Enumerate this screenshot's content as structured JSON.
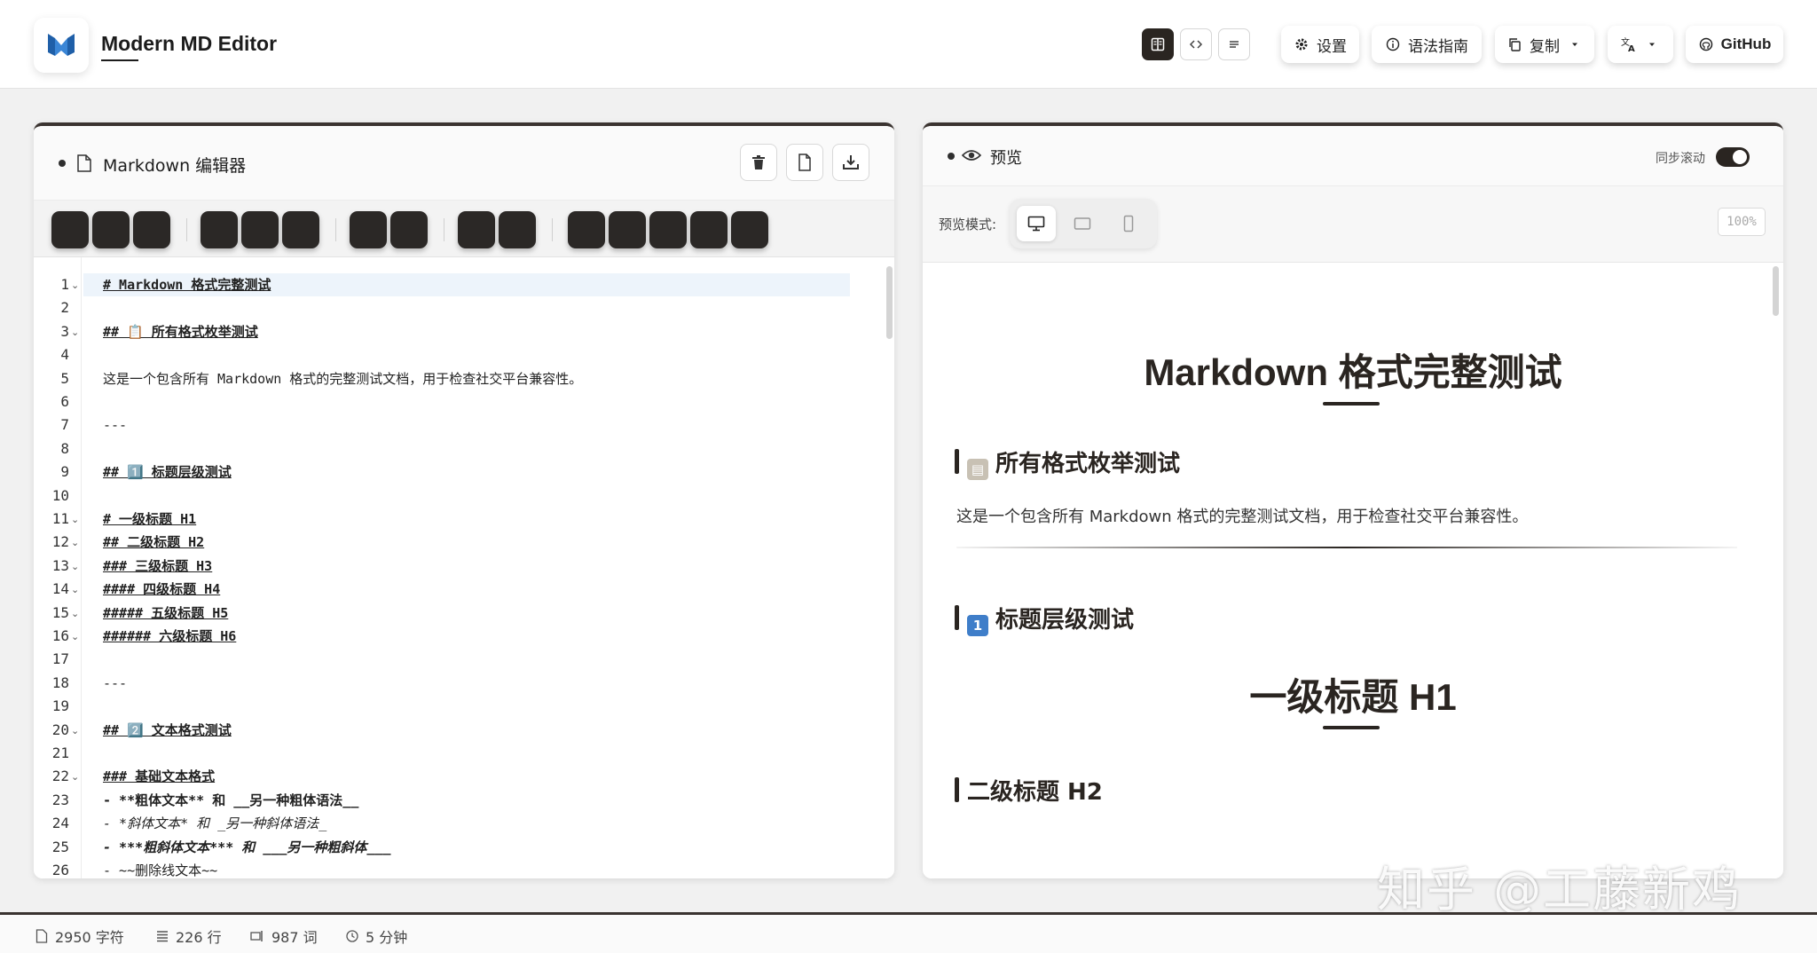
{
  "app": {
    "title": "Modern MD Editor"
  },
  "header": {
    "settings_label": "设置",
    "guide_label": "语法指南",
    "copy_label": "复制",
    "github_label": "GitHub"
  },
  "editor": {
    "title": "Markdown 编辑器",
    "lines": [
      {
        "n": "1",
        "fold": true,
        "text": "# Markdown 格式完整测试",
        "style": "hd"
      },
      {
        "n": "2",
        "fold": false,
        "text": "",
        "style": ""
      },
      {
        "n": "3",
        "fold": true,
        "text": "## 📋 所有格式枚举测试",
        "style": "hd"
      },
      {
        "n": "4",
        "fold": false,
        "text": "",
        "style": ""
      },
      {
        "n": "5",
        "fold": false,
        "text": "这是一个包含所有 Markdown 格式的完整测试文档，用于检查社交平台兼容性。",
        "style": ""
      },
      {
        "n": "6",
        "fold": false,
        "text": "",
        "style": ""
      },
      {
        "n": "7",
        "fold": false,
        "text": "---",
        "style": ""
      },
      {
        "n": "8",
        "fold": false,
        "text": "",
        "style": ""
      },
      {
        "n": "9",
        "fold": false,
        "text": "## 1️⃣ 标题层级测试",
        "style": "hd"
      },
      {
        "n": "10",
        "fold": false,
        "text": "",
        "style": ""
      },
      {
        "n": "11",
        "fold": true,
        "text": "# 一级标题 H1",
        "style": "hd"
      },
      {
        "n": "12",
        "fold": true,
        "text": "## 二级标题 H2",
        "style": "hd"
      },
      {
        "n": "13",
        "fold": true,
        "text": "### 三级标题 H3",
        "style": "hd"
      },
      {
        "n": "14",
        "fold": true,
        "text": "#### 四级标题 H4",
        "style": "hd"
      },
      {
        "n": "15",
        "fold": true,
        "text": "##### 五级标题 H5",
        "style": "hd"
      },
      {
        "n": "16",
        "fold": true,
        "text": "###### 六级标题 H6",
        "style": "hd"
      },
      {
        "n": "17",
        "fold": false,
        "text": "",
        "style": ""
      },
      {
        "n": "18",
        "fold": false,
        "text": "---",
        "style": ""
      },
      {
        "n": "19",
        "fold": false,
        "text": "",
        "style": ""
      },
      {
        "n": "20",
        "fold": true,
        "text": "## 2️⃣ 文本格式测试",
        "style": "hd"
      },
      {
        "n": "21",
        "fold": false,
        "text": "",
        "style": ""
      },
      {
        "n": "22",
        "fold": true,
        "text": "### 基础文本格式",
        "style": "hd"
      },
      {
        "n": "23",
        "fold": false,
        "text": "- **粗体文本** 和 __另一种粗体语法__",
        "style": "bd"
      },
      {
        "n": "24",
        "fold": false,
        "text": "- *斜体文本* 和 _另一种斜体语法_",
        "style": "em"
      },
      {
        "n": "25",
        "fold": false,
        "text": "- ***粗斜体文本*** 和 ___另一种粗斜体___",
        "style": "bd em"
      },
      {
        "n": "26",
        "fold": false,
        "text": "- ~~删除线文本~~",
        "style": ""
      }
    ]
  },
  "preview": {
    "title": "预览",
    "sync_label": "同步滚动",
    "mode_label": "预览模式:",
    "zoom": "100%",
    "h1": "Markdown 格式完整测试",
    "h2_enum": "所有格式枚举测试",
    "paragraph": "这是一个包含所有 Markdown 格式的完整测试文档，用于检查社交平台兼容性。",
    "h2_levels": "标题层级测试",
    "h1_demo": "一级标题 H1",
    "h2_demo": "二级标题 H2",
    "num1": "1",
    "clip": "▤"
  },
  "footer": {
    "chars": "2950 字符",
    "lines": "226 行",
    "words": "987 词",
    "time": "5 分钟"
  },
  "watermark": "知乎 @工藤新鸡",
  "colors": {
    "accent": "#2a2521",
    "background": "#f1f1f1"
  }
}
